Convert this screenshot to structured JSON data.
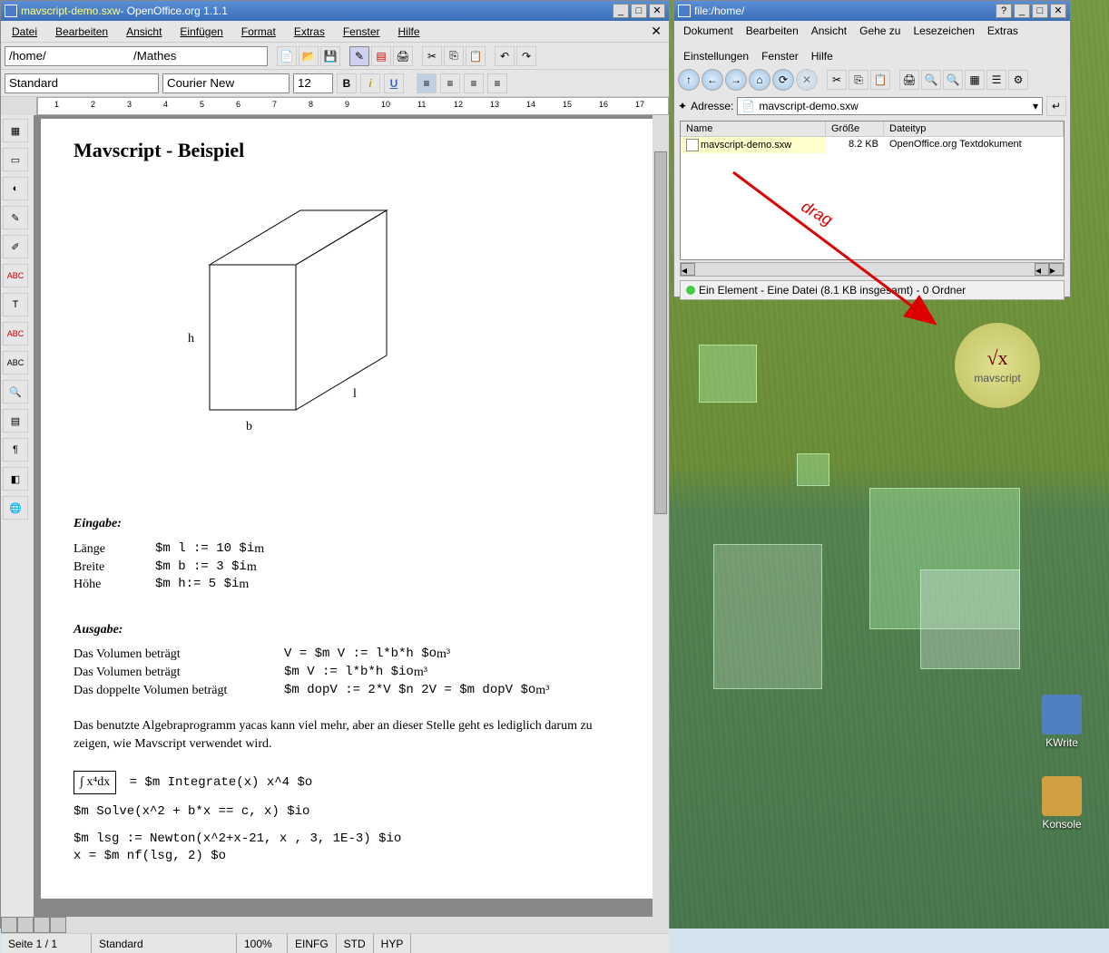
{
  "oo": {
    "title_file": "mavscript-demo.sxw",
    "title_app": " - OpenOffice.org 1.1.1",
    "menu": [
      "Datei",
      "Bearbeiten",
      "Ansicht",
      "Einfügen",
      "Format",
      "Extras",
      "Fenster",
      "Hilfe"
    ],
    "path": "/home/                          /Mathes",
    "style": "Standard",
    "font": "Courier New",
    "size": "12",
    "ruler_marks": [
      "1",
      "2",
      "3",
      "4",
      "5",
      "6",
      "7",
      "8",
      "9",
      "10",
      "11",
      "12",
      "13",
      "14",
      "15",
      "16",
      "17"
    ],
    "doc": {
      "heading": "Mavscript - Beispiel",
      "cube_labels": {
        "h": "h",
        "b": "b",
        "l": "l"
      },
      "eingabe_h": "Eingabe:",
      "inputs": [
        {
          "label": "Länge",
          "code": "$m l := 10 $i",
          "unit": "m"
        },
        {
          "label": "Breite",
          "code": "$m b := 3 $i",
          "unit": "m"
        },
        {
          "label": "Höhe",
          "code": "$m h:= 5 $i",
          "unit": "m"
        }
      ],
      "ausgabe_h": "Ausgabe:",
      "outputs": [
        {
          "label": "Das Volumen beträgt",
          "code": "V = $m V := l*b*h $o",
          "unit": "m³"
        },
        {
          "label": "Das Volumen beträgt",
          "code": "$m V := l*b*h $io",
          "unit": "m³"
        },
        {
          "label": "Das doppelte Volumen beträgt",
          "code": "$m dopV := 2*V $n 2V = $m dopV $o",
          "unit": "m³"
        }
      ],
      "body": "Das benutzte Algebraprogramm yacas kann viel mehr, aber an dieser Stelle geht es lediglich darum zu zeigen, wie Mavscript verwendet wird.",
      "integral": "∫ x⁴dx",
      "integral_code": " = $m Integrate(x) x^4 $o",
      "code1": "$m Solve(x^2 + b*x == c, x) $io",
      "code2": "$m lsg := Newton(x^2+x-21, x , 3, 1E-3) $io",
      "code3": "x = $m nf(lsg, 2) $o"
    },
    "status": {
      "page": "Seite 1 / 1",
      "style": "Standard",
      "zoom": "100%",
      "insert": "EINFG",
      "std": "STD",
      "hyp": "HYP"
    }
  },
  "fb": {
    "title": "file:/home/",
    "menu": [
      "Dokument",
      "Bearbeiten",
      "Ansicht",
      "Gehe zu",
      "Lesezeichen",
      "Extras",
      "Einstellungen",
      "Fenster",
      "Hilfe"
    ],
    "addr_label": "Adresse:",
    "addr": "                                   mavscript-demo.sxw",
    "cols": {
      "name": "Name",
      "size": "Größe",
      "type": "Dateityp"
    },
    "file": {
      "name": "mavscript-demo.sxw",
      "size": "8.2 KB",
      "type": "OpenOffice.org Textdokument"
    },
    "status": "Ein Element - Eine Datei (8.1 KB insgesamt) - 0 Ordner"
  },
  "drag_label": "drag",
  "mavscript": {
    "formula": "√x",
    "label": "mavscript"
  },
  "desk": {
    "kwrite": "KWrite",
    "konsole": "Konsole"
  }
}
